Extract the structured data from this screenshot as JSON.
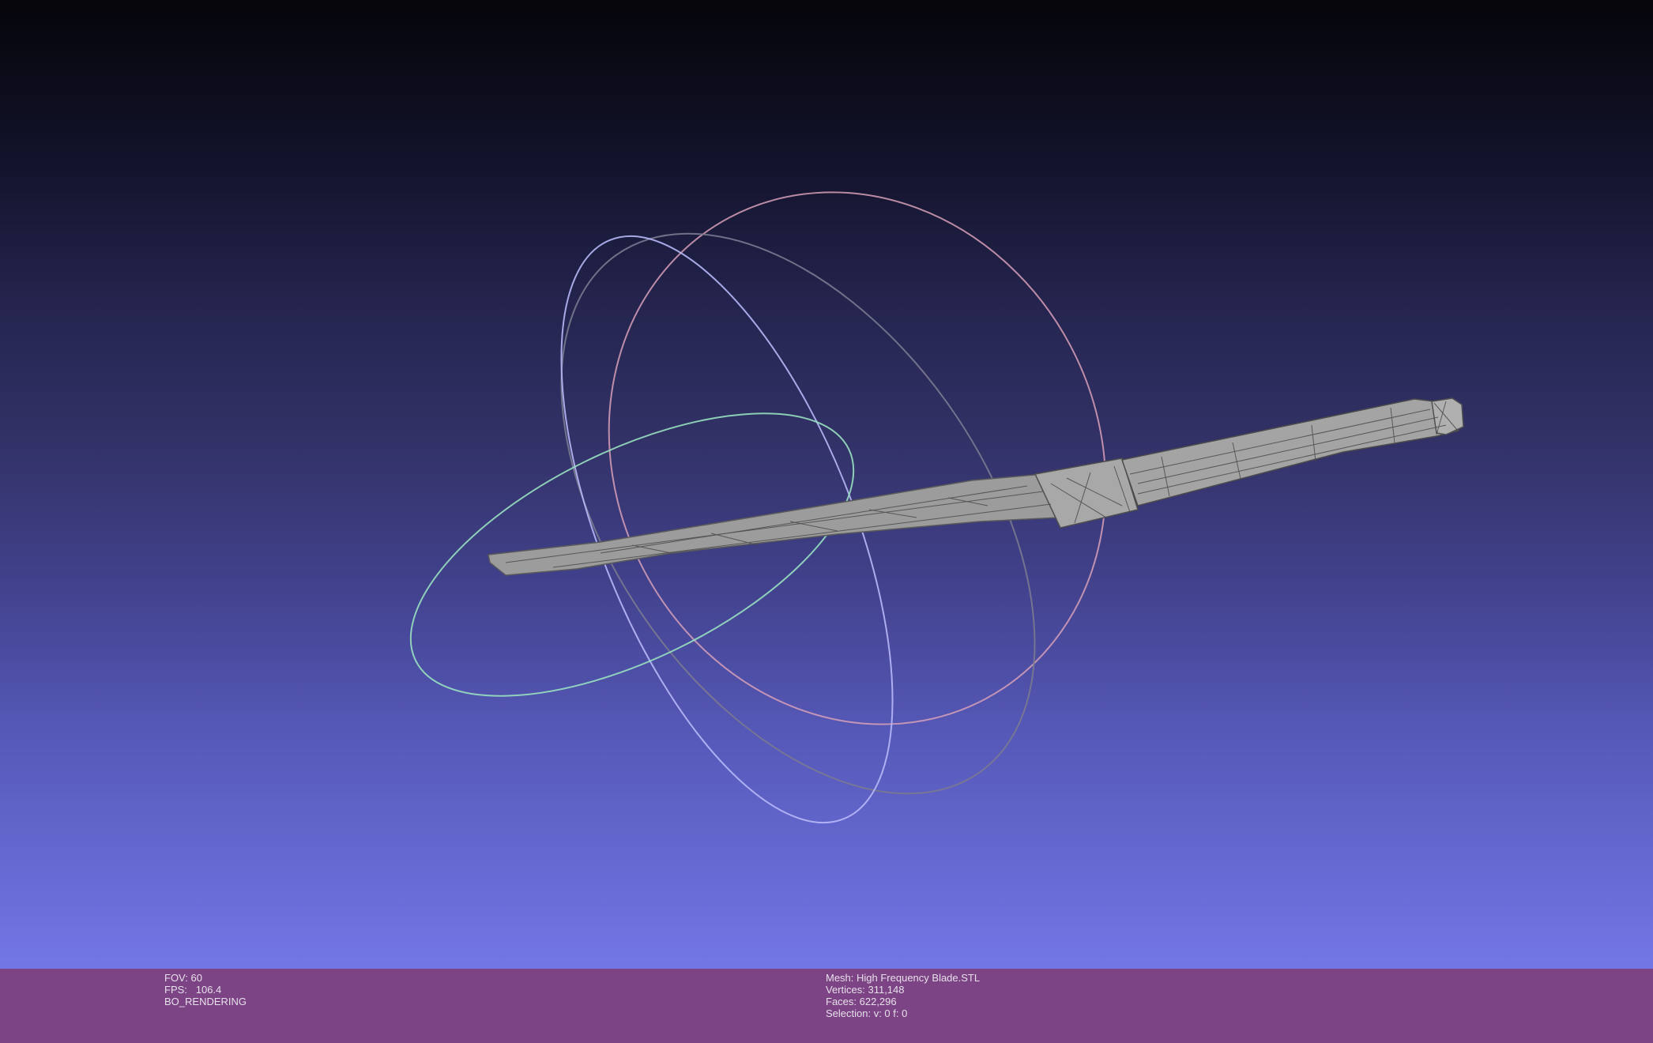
{
  "viewport": {
    "background_top": "#05050a",
    "background_bottom": "#7376e6",
    "mesh_color": "#8c8c8c",
    "trackball_colors": {
      "x_ring": "#e8a0a8",
      "y_ring": "#a8f0c8",
      "z_ring": "#c0c0ff",
      "gray_ring": "#8a8aa0"
    }
  },
  "infobar": {
    "background": "#7d4485",
    "left": {
      "fov": "FOV: 60",
      "fps": "FPS:   106.4",
      "rendering_mode": "BO_RENDERING"
    },
    "right": {
      "mesh": "Mesh: High Frequency Blade.STL",
      "vertices": "Vertices: 311,148",
      "faces": "Faces: 622,296",
      "selection": "Selection: v: 0 f: 0"
    }
  }
}
